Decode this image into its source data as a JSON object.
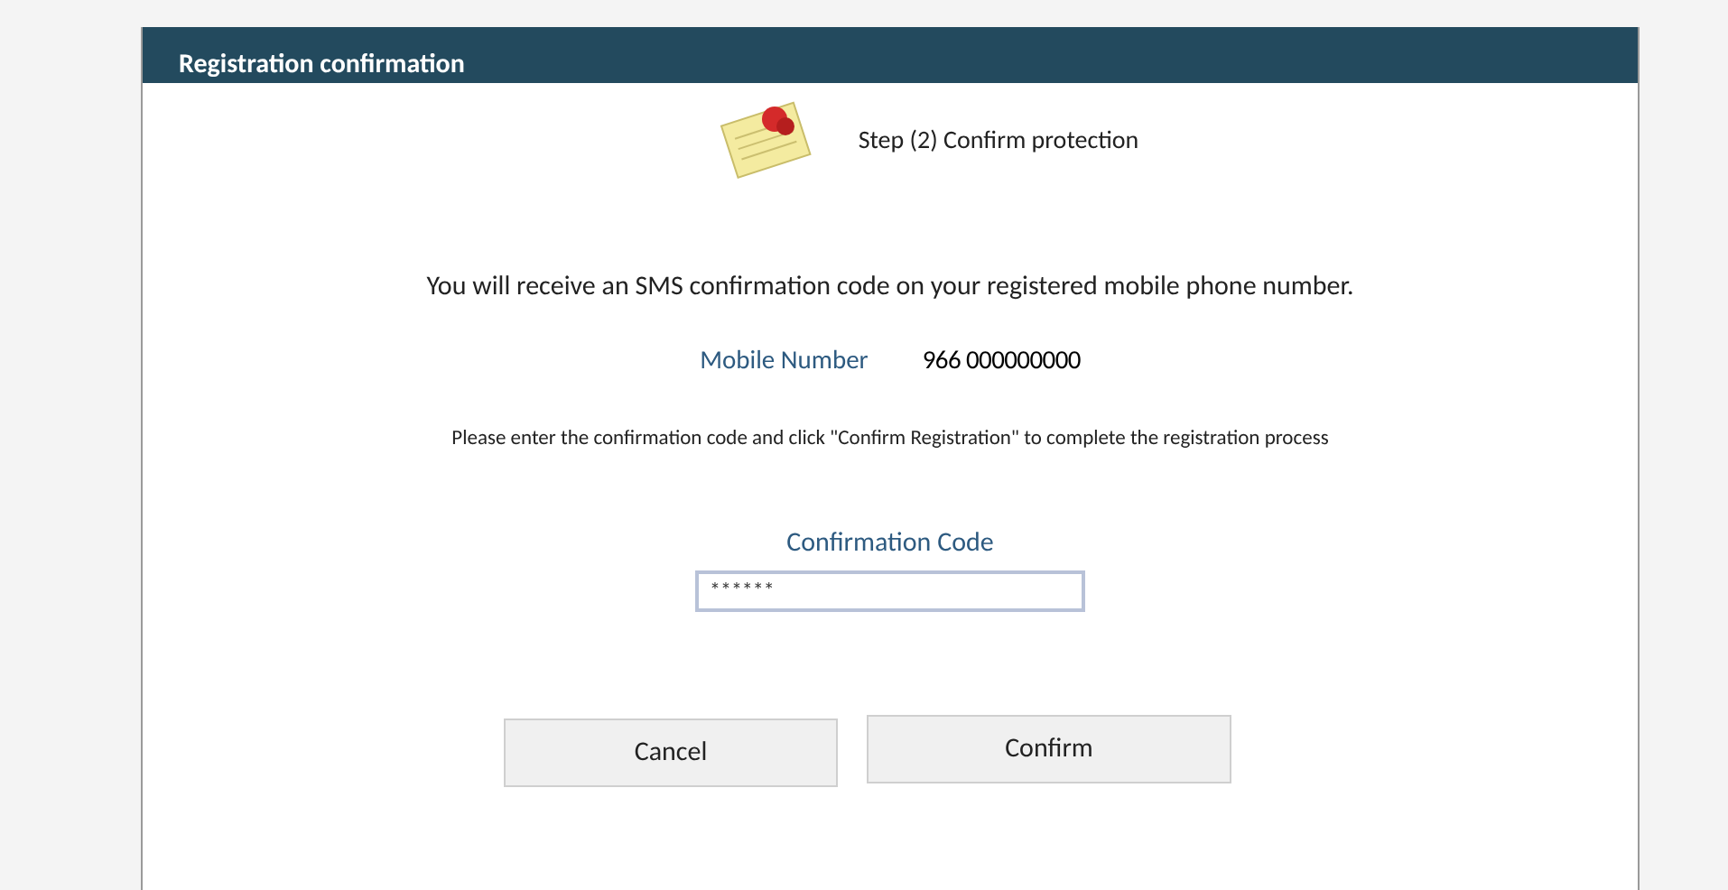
{
  "window": {
    "title": "Registration confirmation"
  },
  "step": {
    "label": "Step (2) Confirm protection"
  },
  "message": "You will receive an SMS confirmation code on your registered mobile phone number.",
  "mobile": {
    "label": "Mobile Number",
    "value": "966 000000000"
  },
  "instruction": "Please enter the confirmation code and click \"Confirm Registration\" to complete the registration process",
  "code_field": {
    "label": "Confirmation Code",
    "value": "******"
  },
  "buttons": [
    "Cancel",
    "Confirm"
  ]
}
